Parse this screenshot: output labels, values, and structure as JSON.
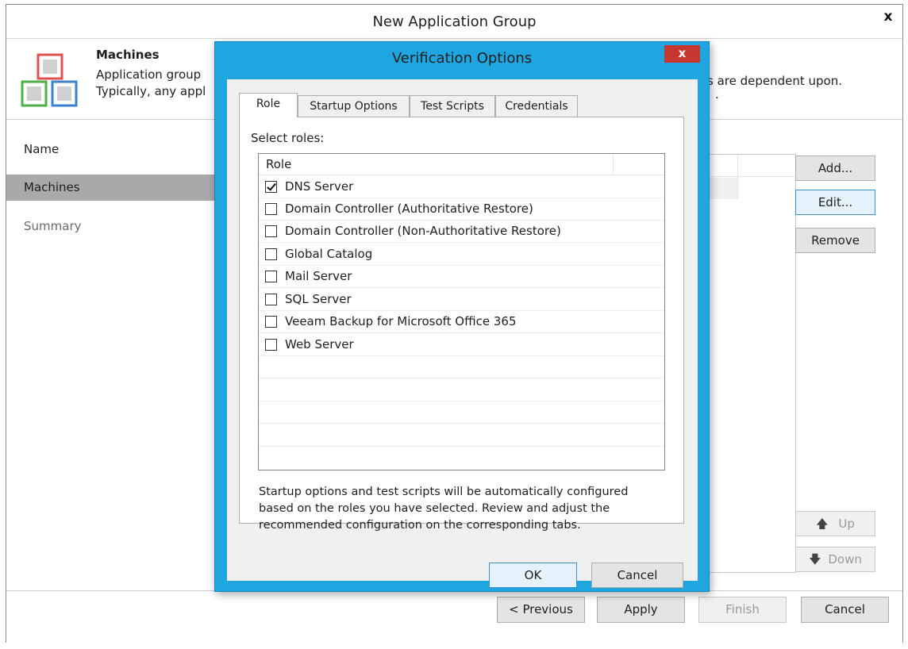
{
  "window": {
    "title": "New Application Group",
    "close_label": "x"
  },
  "header": {
    "title": "Machines",
    "desc_line1": "Application group",
    "desc_line2": "Typically, any appl",
    "desc_tail": "s are dependent upon.",
    "desc_tail2": "."
  },
  "nav": {
    "items": [
      {
        "label": "Name"
      },
      {
        "label": "Machines"
      },
      {
        "label": "Summary"
      }
    ]
  },
  "side_buttons": {
    "add": "Add...",
    "edit": "Edit...",
    "remove": "Remove",
    "up": "Up",
    "down": "Down"
  },
  "footer": {
    "previous": "< Previous",
    "apply": "Apply",
    "finish": "Finish",
    "cancel": "Cancel"
  },
  "modal": {
    "title": "Verification Options",
    "close_label": "x",
    "tabs": [
      {
        "label": "Role",
        "active": true
      },
      {
        "label": "Startup Options"
      },
      {
        "label": "Test Scripts"
      },
      {
        "label": "Credentials"
      }
    ],
    "select_label": "Select roles:",
    "column_header": "Role",
    "roles": [
      {
        "label": "DNS Server",
        "checked": true
      },
      {
        "label": "Domain Controller (Authoritative Restore)",
        "checked": false
      },
      {
        "label": "Domain Controller (Non-Authoritative Restore)",
        "checked": false
      },
      {
        "label": "Global Catalog",
        "checked": false
      },
      {
        "label": "Mail Server",
        "checked": false
      },
      {
        "label": "SQL Server",
        "checked": false
      },
      {
        "label": "Veeam Backup for Microsoft Office 365",
        "checked": false
      },
      {
        "label": "Web Server",
        "checked": false
      }
    ],
    "help_lines": [
      "Startup options and test scripts will be automatically configured",
      "based on the roles you have selected. Review and adjust the",
      "recommended configuration on the corresponding tabs."
    ],
    "ok": "OK",
    "cancel": "Cancel"
  },
  "colors": {
    "accent_border": "#1fa5e0",
    "close_red": "#c7372f",
    "nav_active": "#a9a9a9"
  }
}
